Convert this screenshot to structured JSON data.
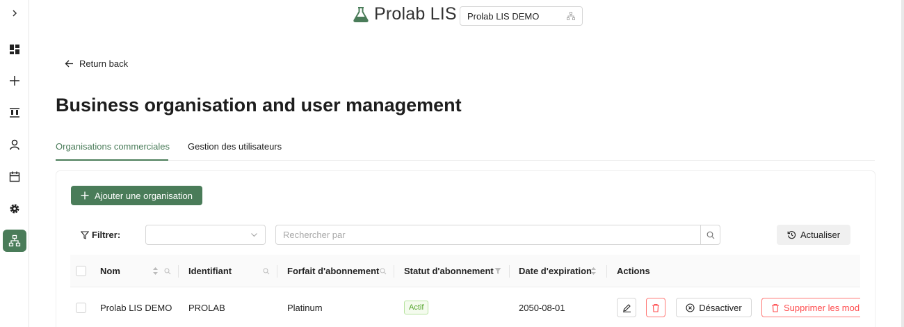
{
  "header": {
    "brand_title": "Prolab LIS",
    "org_selector_value": "Prolab LIS DEMO"
  },
  "sidebar": {
    "items": [
      {
        "name": "expand",
        "icon": "chevron-right-icon"
      },
      {
        "name": "dashboard",
        "icon": "dashboard-icon"
      },
      {
        "name": "add",
        "icon": "plus-icon"
      },
      {
        "name": "samples",
        "icon": "test-tubes-icon"
      },
      {
        "name": "patients",
        "icon": "user-icon"
      },
      {
        "name": "calendar",
        "icon": "calendar-icon"
      },
      {
        "name": "settings",
        "icon": "gear-icon"
      },
      {
        "name": "organisations",
        "icon": "org-chart-icon",
        "active": true
      }
    ]
  },
  "nav": {
    "return_label": "Return back"
  },
  "page": {
    "title": "Business organisation and user management"
  },
  "tabs": [
    {
      "label": "Organisations commerciales",
      "active": true
    },
    {
      "label": "Gestion des utilisateurs",
      "active": false
    }
  ],
  "toolbar": {
    "add_label": "Ajouter une organisation",
    "filter_label": "Filtrer:",
    "filter_value": "",
    "search_placeholder": "Rechercher par",
    "refresh_label": "Actualiser"
  },
  "table": {
    "columns": [
      "Nom",
      "Identifiant",
      "Forfait d'abonnement",
      "Statut d'abonnement",
      "Date d'expiration",
      "Actions"
    ],
    "rows": [
      {
        "name": "Prolab LIS DEMO",
        "identifier": "PROLAB",
        "plan": "Platinum",
        "status": "Actif",
        "expiration": "2050-08-01",
        "deactivate_label": "Désactiver",
        "delete_modules_label": "Supprimer les mod"
      }
    ]
  },
  "colors": {
    "accent": "#4a7c59",
    "danger": "#ff4d4f",
    "success": "#52a32a"
  }
}
